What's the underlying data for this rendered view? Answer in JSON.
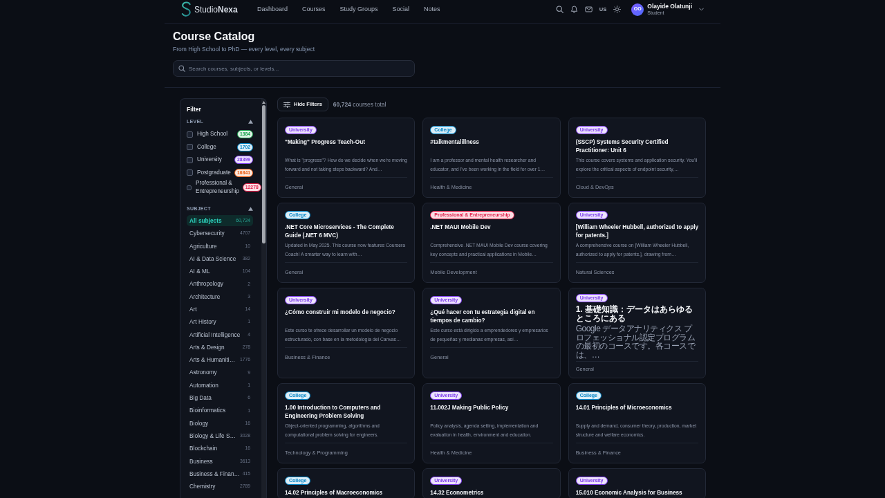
{
  "header": {
    "brand": "Studio**Nexa**",
    "nav": [
      "Dashboard",
      "Courses",
      "Study Groups",
      "Social",
      "Notes"
    ],
    "language": "US",
    "user": {
      "initials": "OO",
      "name": "Olayide Olatunji",
      "role": "Student"
    }
  },
  "catalog": {
    "title": "Course Catalog",
    "subtitle": "From High School to PhD — every level, every subject",
    "search": {
      "placeholder": "Search courses, subjects, or levels..."
    }
  },
  "toolbar": {
    "filter_button": "Hide Filters",
    "total": "**60,724** courses total"
  },
  "filter": {
    "title": "Filter",
    "level": {
      "heading": "LEVEL",
      "expanded": true,
      "items": [
        {
          "label": "High School",
          "count": "1384",
          "checked": false,
          "color": "#16a34a"
        },
        {
          "label": "College",
          "count": "1702",
          "checked": false,
          "color": "#0284c7"
        },
        {
          "label": "University",
          "count": "28399",
          "checked": false,
          "color": "#7c3aed"
        },
        {
          "label": "Postgraduate",
          "count": "16841",
          "checked": false,
          "color": "#ea580c"
        },
        {
          "label": "Professional & Entrepreneurship",
          "count": "12278",
          "checked": false,
          "color": "#e11d48"
        }
      ]
    },
    "subject": {
      "heading": "SUBJECT",
      "expanded": true,
      "items": [
        {
          "name": "All subjects",
          "count": "60,724",
          "selected": true
        },
        {
          "name": "Cybersecurity",
          "count": "4707",
          "selected": false
        },
        {
          "name": "Agriculture",
          "count": "10",
          "selected": false
        },
        {
          "name": "AI & Data Science",
          "count": "382",
          "selected": false
        },
        {
          "name": "AI & ML",
          "count": "104",
          "selected": false
        },
        {
          "name": "Anthropology",
          "count": "2",
          "selected": false
        },
        {
          "name": "Architecture",
          "count": "3",
          "selected": false
        },
        {
          "name": "Art",
          "count": "14",
          "selected": false
        },
        {
          "name": "Art History",
          "count": "1",
          "selected": false
        },
        {
          "name": "Artificial Intelligence",
          "count": "4",
          "selected": false
        },
        {
          "name": "Arts & Design",
          "count": "278",
          "selected": false
        },
        {
          "name": "Arts & Humaniti…",
          "count": "1776",
          "selected": false
        },
        {
          "name": "Astronomy",
          "count": "9",
          "selected": false
        },
        {
          "name": "Automation",
          "count": "1",
          "selected": false
        },
        {
          "name": "Big Data",
          "count": "6",
          "selected": false
        },
        {
          "name": "Bioinformatics",
          "count": "1",
          "selected": false
        },
        {
          "name": "Biology",
          "count": "16",
          "selected": false
        },
        {
          "name": "Biology & Life S…",
          "count": "3028",
          "selected": false
        },
        {
          "name": "Blockchain",
          "count": "16",
          "selected": false
        },
        {
          "name": "Business",
          "count": "3613",
          "selected": false
        },
        {
          "name": "Business & Finan…",
          "count": "415",
          "selected": false
        },
        {
          "name": "Chemistry",
          "count": "2789",
          "selected": false
        }
      ]
    }
  },
  "courses": [
    {
      "level": "University",
      "color": "#7c3aed",
      "title": "\"Making\" Progress Teach-Out",
      "description": "What is \"progress\"? How do we decide when we're moving forward and not taking steps backward? And…",
      "subject": "General"
    },
    {
      "level": "College",
      "color": "#0284c7",
      "title": "#talkmentalillness",
      "description": "I am a professor and mental health researcher and educator, and I've been working in the field for over 1…",
      "subject": "Health & Medicine"
    },
    {
      "level": "University",
      "color": "#7c3aed",
      "title": "(SSCP) Systems Security Certified Practitioner: Unit 6",
      "description": "This course covers systems and application security. You'll explore the critical aspects of endpoint security,…",
      "subject": "Cloud & DevOps"
    },
    {
      "level": "College",
      "color": "#0284c7",
      "title": ".NET Core Microservices - The Complete Guide (.NET 6 MVC)",
      "description": "Updated in May 2025. This course now features Coursera Coach! A smarter way to learn with…",
      "subject": "General"
    },
    {
      "level": "Professional & Entrepreneurship",
      "color": "#e11d48",
      "title": ".NET MAUI Mobile Dev",
      "description": "Comprehensive .NET MAUI Mobile Dev course covering key concepts and practical applications in Mobile…",
      "subject": "Mobile Development"
    },
    {
      "level": "University",
      "color": "#7c3aed",
      "title": "[William Wheeler Hubbell, authorized to apply for patents.]",
      "description": "A comprehensive course on [William Wheeler Hubbell, authorized to apply for patents.], drawing from…",
      "subject": "Natural Sciences"
    },
    {
      "level": "University",
      "color": "#7c3aed",
      "title": "¿Cómo construir mi modelo de negocio?",
      "description": "Este curso te ofrece desarrollar un modelo de negocio estructurado, con base en la metodología del Canvas…",
      "subject": "Business & Finance"
    },
    {
      "level": "University",
      "color": "#7c3aed",
      "title": "¿Qué hacer con tu estrategia digital en tiempos de cambio?",
      "description": "Este curso está dirigido a emprendedores y empresarios de pequeñas y medianas empresas, así…",
      "subject": "General"
    },
    {
      "level": "University",
      "color": "#7c3aed",
      "title": "1. 基礎知識：データはあらゆるところにある",
      "description": "Google データアナリティクス プロフェッショナル認定プログラムの最初のコースです。各コースでは、…",
      "subject": "General"
    },
    {
      "level": "College",
      "color": "#0284c7",
      "title": "1.00 Introduction to Computers and Engineering Problem Solving",
      "description": "Object-oriented programming, algorithms and computational problem solving for engineers.",
      "subject": "Technology & Programming"
    },
    {
      "level": "University",
      "color": "#7c3aed",
      "title": "11.002J Making Public Policy",
      "description": "Policy analysis, agenda setting, implementation and evaluation in health, environment and education.",
      "subject": "Health & Medicine"
    },
    {
      "level": "College",
      "color": "#0284c7",
      "title": "14.01 Principles of Microeconomics",
      "description": "Supply and demand, consumer theory, production, market structure and welfare economics.",
      "subject": "Business & Finance"
    },
    {
      "level": "College",
      "color": "#0284c7",
      "title": "14.02 Principles of Macroeconomics"
    },
    {
      "level": "University",
      "color": "#7c3aed",
      "title": "14.32 Econometrics"
    },
    {
      "level": "University",
      "color": "#7c3aed",
      "title": "15.010 Economic Analysis for Business"
    }
  ]
}
